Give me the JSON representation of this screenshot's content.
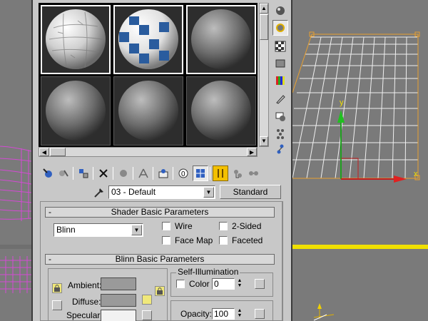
{
  "editor": {
    "samples": [
      {
        "name": "map-sphere",
        "active": true
      },
      {
        "name": "checker-sphere",
        "active": true
      },
      {
        "name": "default-sphere",
        "active": false
      },
      {
        "name": "default-sphere",
        "active": false
      },
      {
        "name": "default-sphere",
        "active": false
      },
      {
        "name": "default-sphere",
        "active": false
      }
    ],
    "side_tools": [
      "sample-type-icon",
      "backlight-icon",
      "background-checker-icon",
      "uv-tiling-icon",
      "video-color-check-icon",
      "make-preview-icon",
      "options-icon",
      "select-by-material-icon",
      "material-map-navigator-icon"
    ],
    "bottom_tools": [
      "get-material-icon",
      "put-to-scene-icon",
      "assign-to-selection-icon",
      "reset-map-icon",
      "copy-material-icon",
      "make-unique-icon",
      "put-to-library-icon",
      "material-id-channel-icon",
      "show-map-in-viewport-icon",
      "show-end-result-icon",
      "go-to-parent-icon",
      "go-forward-to-sibling-icon"
    ],
    "material_name": "03 - Default",
    "material_type": "Standard"
  },
  "shader_rollout": {
    "title": "Shader Basic Parameters",
    "toggle": "-",
    "shader": "Blinn",
    "wire": "Wire",
    "two_sided": "2-Sided",
    "face_map": "Face Map",
    "faceted": "Faceted"
  },
  "blinn_rollout": {
    "title": "Blinn Basic Parameters",
    "toggle": "-",
    "ambient": "Ambient:",
    "diffuse": "Diffuse:",
    "specular": "Specular:",
    "self_illum_title": "Self-Illumination",
    "color": "Color",
    "color_value": "0",
    "opacity": "Opacity:",
    "opacity_value": "100",
    "ambient_color": "#9a9a9a",
    "diffuse_color": "#9a9a9a",
    "specular_color": "#f2f2f2"
  },
  "viewport": {
    "accent": "#f0e000",
    "axis_x": "x",
    "axis_y": "y"
  }
}
